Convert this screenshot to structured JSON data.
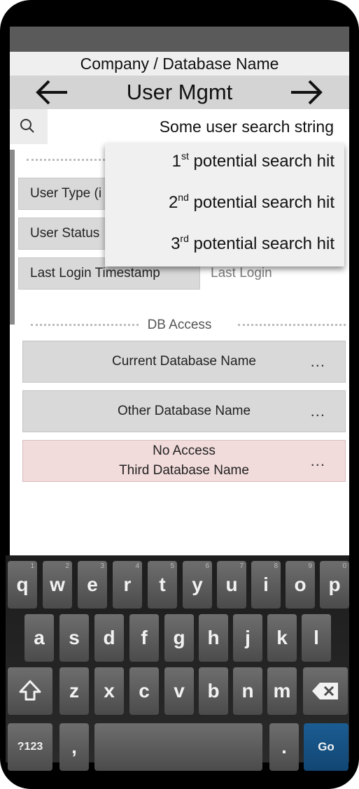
{
  "header": {
    "company": "Company / Database Name",
    "title": "User Mgmt"
  },
  "search": {
    "value": "Some user search string"
  },
  "suggestions": [
    {
      "num": "1",
      "suffix": "st",
      "text": " potential search hit"
    },
    {
      "num": "2",
      "suffix": "nd",
      "text": " potential search hit"
    },
    {
      "num": "3",
      "suffix": "rd",
      "text": " potential search hit"
    }
  ],
  "fields": [
    {
      "label": "User Type (i",
      "value": ""
    },
    {
      "label": "User Status",
      "value": ""
    },
    {
      "label": "Last Login Timestamp",
      "value": "Last Login"
    }
  ],
  "db_access": {
    "section_title": "DB Access",
    "items": [
      {
        "name": "Current Database Name",
        "more": "..."
      },
      {
        "name": "Other Database Name",
        "more": "..."
      },
      {
        "status": "No Access",
        "name": "Third Database Name",
        "more": "..."
      }
    ]
  },
  "keyboard": {
    "row1": [
      {
        "key": "q",
        "hint": "1"
      },
      {
        "key": "w",
        "hint": "2"
      },
      {
        "key": "e",
        "hint": "3"
      },
      {
        "key": "r",
        "hint": "4"
      },
      {
        "key": "t",
        "hint": "5"
      },
      {
        "key": "y",
        "hint": "6"
      },
      {
        "key": "u",
        "hint": "7"
      },
      {
        "key": "i",
        "hint": "8"
      },
      {
        "key": "o",
        "hint": "9"
      },
      {
        "key": "p",
        "hint": "0"
      }
    ],
    "row2": [
      "a",
      "s",
      "d",
      "f",
      "g",
      "h",
      "j",
      "k",
      "l"
    ],
    "row3": [
      "z",
      "x",
      "c",
      "v",
      "b",
      "n",
      "m"
    ],
    "symbols": "?123",
    "comma": ",",
    "period": ".",
    "go": "Go"
  },
  "icons": {
    "back": "arrow-left-icon",
    "forward": "arrow-right-icon",
    "search": "search-icon",
    "shift": "shift-icon",
    "backspace": "backspace-icon"
  },
  "colors": {
    "status_bar": "#5a5a5a",
    "title_bar": "#d4d4d4",
    "no_access": "#f2dbdb",
    "go_key": "#1b5c92"
  }
}
